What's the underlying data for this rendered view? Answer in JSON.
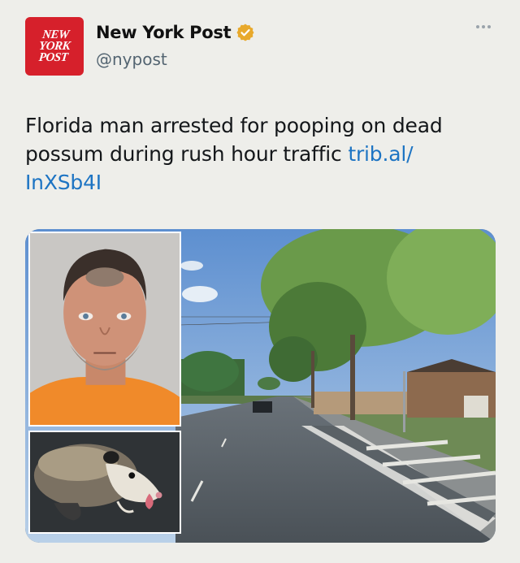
{
  "post": {
    "display_name": "New York Post",
    "handle": "@nypost",
    "avatar_logo_lines": [
      "NEW",
      "YORK",
      "POST"
    ],
    "verified": true,
    "text": "Florida man arrested for pooping on dead possum during rush hour traffic ",
    "link_text": "trib.al/\nInXSb4I"
  },
  "colors": {
    "background": "#eeeeea",
    "brand_red": "#d6202b",
    "verified_badge": "#e8a92c",
    "link": "#1d74c3",
    "handle": "#536471"
  },
  "icons": [
    "verified-badge-icon",
    "more-options-icon"
  ],
  "media": {
    "images": [
      "street-photo",
      "mugshot-photo",
      "possum-photo"
    ]
  }
}
